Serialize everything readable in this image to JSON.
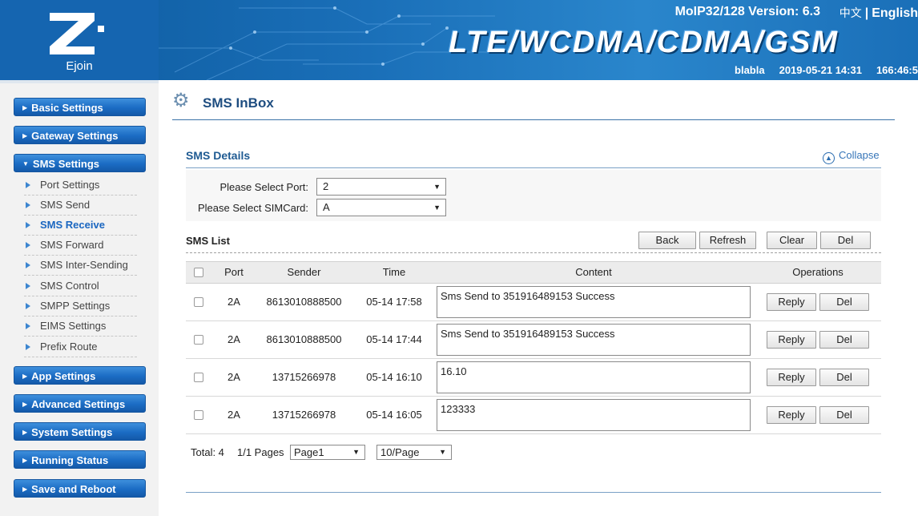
{
  "header": {
    "logo_text": "Ejoin",
    "version": "MoIP32/128 Version: 6.3",
    "lang_cn": "中文",
    "lang_sep": "|",
    "lang_en": "English",
    "tech": "LTE/WCDMA/CDMA/GSM",
    "user": "blabla",
    "datetime": "2019-05-21 14:31",
    "uptime": "166:46:5"
  },
  "sidebar": {
    "groups": [
      {
        "label": "Basic Settings"
      },
      {
        "label": "Gateway Settings"
      },
      {
        "label": "SMS Settings"
      },
      {
        "label": "App Settings"
      },
      {
        "label": "Advanced Settings"
      },
      {
        "label": "System Settings"
      },
      {
        "label": "Running Status"
      },
      {
        "label": "Save and Reboot"
      }
    ],
    "sms_items": [
      {
        "label": "Port Settings"
      },
      {
        "label": "SMS Send"
      },
      {
        "label": "SMS Receive"
      },
      {
        "label": "SMS Forward"
      },
      {
        "label": "SMS Inter-Sending"
      },
      {
        "label": "SMS Control"
      },
      {
        "label": "SMPP Settings"
      },
      {
        "label": "EIMS Settings"
      },
      {
        "label": "Prefix Route"
      }
    ],
    "active_item": "SMS Receive"
  },
  "main": {
    "page_title": "SMS InBox",
    "details_title": "SMS Details",
    "collapse_label": "Collapse",
    "port_label": "Please Select Port:",
    "port_value": "2",
    "sim_label": "Please Select SIMCard:",
    "sim_value": "A",
    "list_title": "SMS List",
    "buttons": {
      "back": "Back",
      "refresh": "Refresh",
      "clear": "Clear",
      "del": "Del"
    },
    "columns": [
      "Port",
      "Sender",
      "Time",
      "Content",
      "Operations"
    ],
    "rows": [
      {
        "port": "2A",
        "sender": "8613010888500",
        "time": "05-14 17:58",
        "content": "Sms Send to 351916489153 Success",
        "reply": "Reply",
        "del": "Del"
      },
      {
        "port": "2A",
        "sender": "8613010888500",
        "time": "05-14 17:44",
        "content": "Sms Send to 351916489153 Success",
        "reply": "Reply",
        "del": "Del"
      },
      {
        "port": "2A",
        "sender": "13715266978",
        "time": "05-14 16:10",
        "content": "16.10",
        "reply": "Reply",
        "del": "Del"
      },
      {
        "port": "2A",
        "sender": "13715266978",
        "time": "05-14 16:05",
        "content": "123333",
        "reply": "Reply",
        "del": "Del"
      }
    ],
    "pager": {
      "total": "Total: 4",
      "pages": "1/1 Pages",
      "page_select": "Page1",
      "per_page_select": "10/Page"
    }
  },
  "colors": {
    "header_blue": "#1565b0",
    "menu_blue": "#1b6cc4",
    "title_blue": "#1e4d80",
    "active_link": "#1a66c0"
  }
}
